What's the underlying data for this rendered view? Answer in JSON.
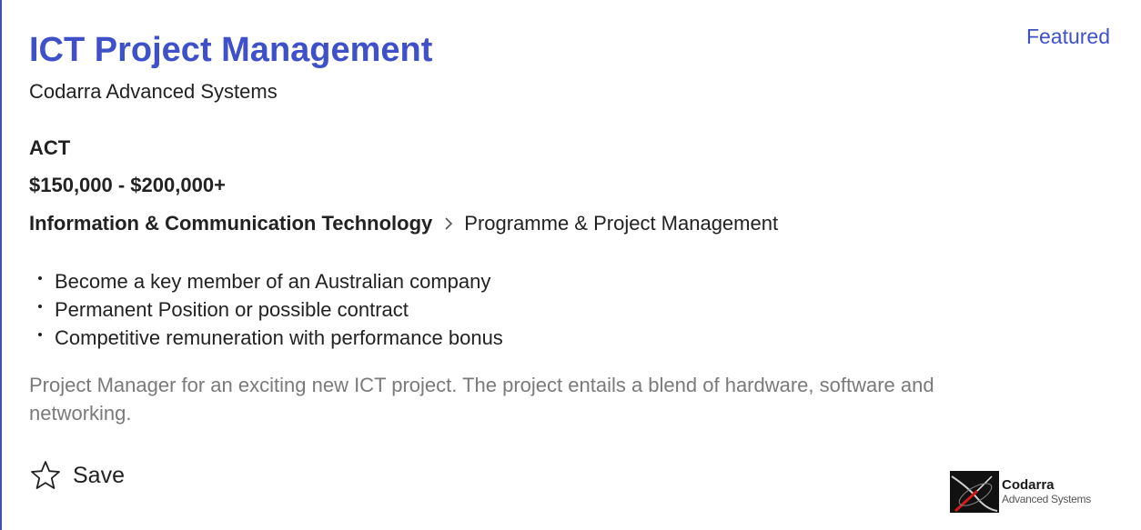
{
  "job": {
    "title": "ICT Project Management",
    "featured_label": "Featured",
    "company": "Codarra Advanced Systems",
    "location": "ACT",
    "salary": "$150,000 - $200,000+",
    "classification": "Information & Communication Technology",
    "subclassification": "Programme & Project Management",
    "bullets": [
      "Become a key member of an Australian company",
      "Permanent Position or possible contract",
      "Competitive remuneration with performance bonus"
    ],
    "teaser": "Project Manager for an exciting new ICT project. The project entails a blend of hardware, software and networking.",
    "save_label": "Save",
    "logo": {
      "name_line1": "Codarra",
      "name_line2": "Advanced Systems"
    }
  },
  "colors": {
    "accent": "#3f51c8",
    "text": "#222222",
    "muted": "#7a7a7a"
  },
  "icons": {
    "chevron": "chevron-right-icon",
    "save": "star-outline-icon"
  }
}
